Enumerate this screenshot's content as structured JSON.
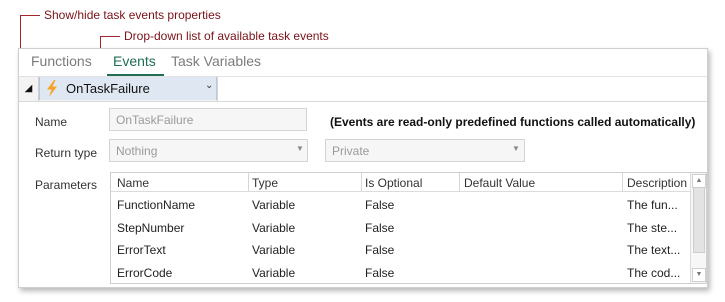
{
  "annotations": {
    "show_hide": "Show/hide task events properties",
    "dropdown": "Drop-down list of available task events"
  },
  "tabs": [
    {
      "label": "Functions",
      "active": false
    },
    {
      "label": "Events",
      "active": true
    },
    {
      "label": "Task Variables",
      "active": false
    }
  ],
  "toolbar": {
    "toggle_glyph": "◢",
    "event_icon": "lightning-bolt-icon",
    "selected_event": "OnTaskFailure",
    "chevron_glyph": "⌄"
  },
  "form": {
    "name_label": "Name",
    "name_value": "OnTaskFailure",
    "note": "(Events are read-only predefined functions called automatically)",
    "return_type_label": "Return type",
    "return_type_value": "Nothing",
    "access_value": "Private",
    "parameters_label": "Parameters"
  },
  "parameters": {
    "columns": [
      "Name",
      "Type",
      "Is Optional",
      "Default Value",
      "Description"
    ],
    "rows": [
      [
        "FunctionName",
        "Variable",
        "False",
        "",
        "The fun..."
      ],
      [
        "StepNumber",
        "Variable",
        "False",
        "",
        "The ste..."
      ],
      [
        "ErrorText",
        "Variable",
        "False",
        "",
        "The text..."
      ],
      [
        "ErrorCode",
        "Variable",
        "False",
        "",
        "The cod..."
      ]
    ]
  },
  "colors": {
    "accent": "#1f6e55",
    "annotation": "#a3262d",
    "selection": "#dfe8f2"
  }
}
